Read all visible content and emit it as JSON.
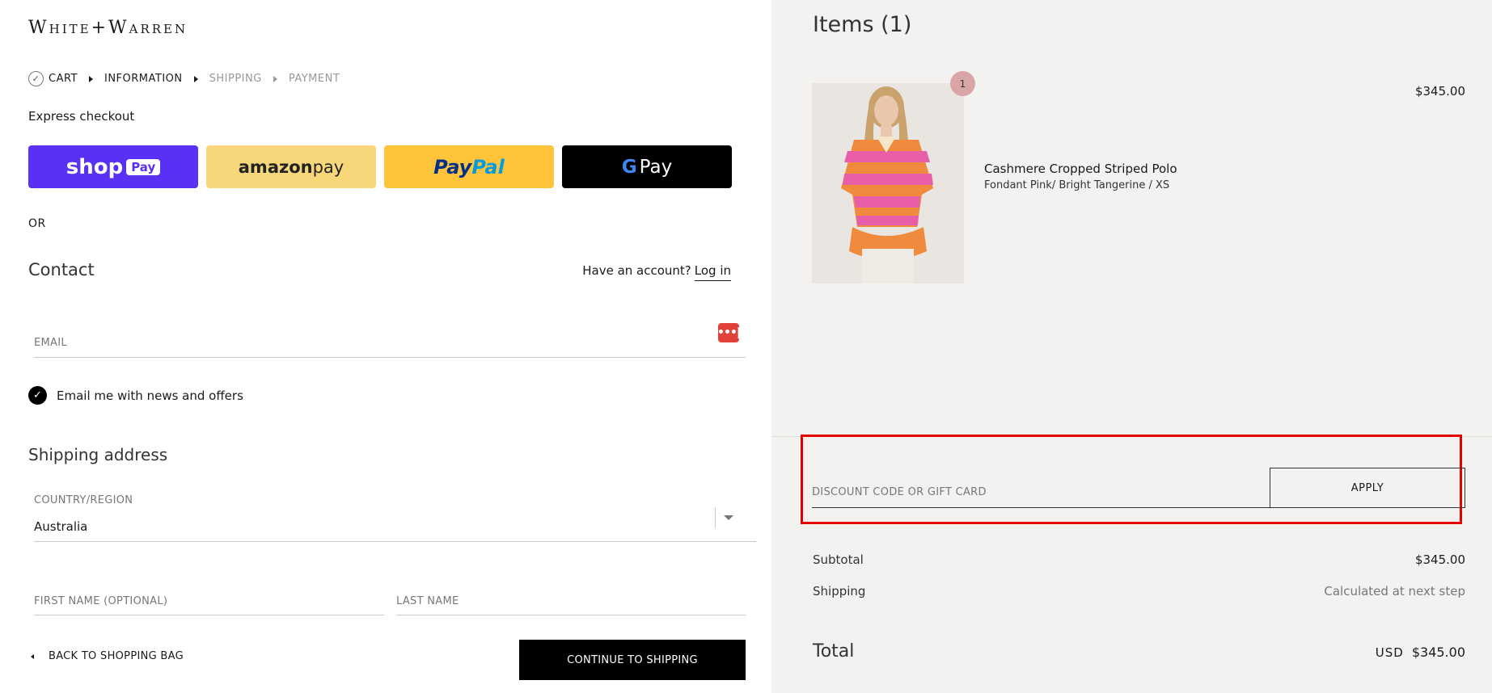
{
  "brand": "White+Warren",
  "breadcrumb": {
    "cart": "CART",
    "information": "INFORMATION",
    "shipping": "SHIPPING",
    "payment": "PAYMENT"
  },
  "express": {
    "title": "Express checkout",
    "shop_label": "shop",
    "shop_tag": "Pay",
    "amazon_a": "amazon",
    "amazon_b": " pay",
    "paypal_a": "Pay",
    "paypal_b": "Pal",
    "gpay_g": "G",
    "gpay_label": "Pay"
  },
  "or_label": "OR",
  "contact": {
    "title": "Contact",
    "have_account": "Have an account?",
    "login": "Log in",
    "email_placeholder": "EMAIL",
    "newsletter": "Email me with news and offers"
  },
  "shipping_address": {
    "title": "Shipping address",
    "country_label": "COUNTRY/REGION",
    "country_value": "Australia",
    "first_name": "FIRST NAME (OPTIONAL)",
    "last_name": "LAST NAME"
  },
  "footer": {
    "back": "BACK TO SHOPPING BAG",
    "continue": "CONTINUE TO SHIPPING"
  },
  "summary": {
    "items_title": "Items (1)",
    "product": {
      "qty": "1",
      "name": "Cashmere Cropped Striped Polo",
      "variant": "Fondant Pink/ Bright Tangerine / XS",
      "price": "$345.00"
    },
    "discount_placeholder": "DISCOUNT CODE OR GIFT CARD",
    "apply": "APPLY",
    "subtotal_label": "Subtotal",
    "subtotal_value": "$345.00",
    "shipping_label": "Shipping",
    "shipping_value": "Calculated at next step",
    "total_label": "Total",
    "total_currency": "USD",
    "total_value": "$345.00"
  },
  "colors": {
    "shop_pay": "#5a31f4",
    "amazon_pay": "#f7d779",
    "paypal": "#ffc439",
    "highlight": "#e50000",
    "summary_bg": "#f3f2f0"
  }
}
